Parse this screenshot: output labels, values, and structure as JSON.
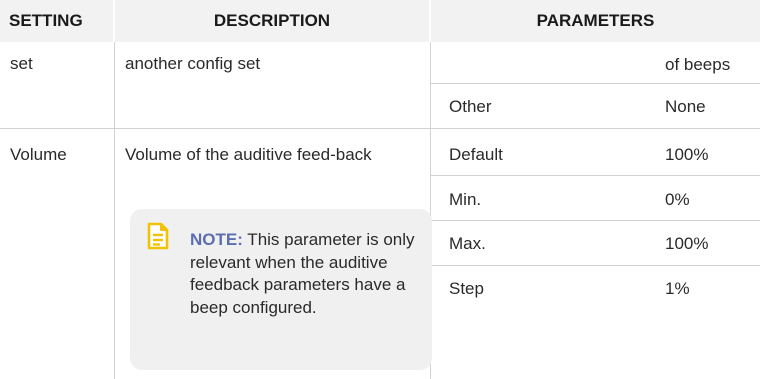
{
  "table": {
    "headers": {
      "setting": "SETTING",
      "description": "DESCRIPTION",
      "parameters": "PARAMETERS"
    },
    "row1": {
      "setting": "set",
      "description": "another config set",
      "params": [
        {
          "name": "",
          "value": "of beeps"
        },
        {
          "name": "Other",
          "value": "None"
        }
      ]
    },
    "row2": {
      "setting": "Volume",
      "description": "Volume of the auditive feed-back",
      "params": [
        {
          "name": "Default",
          "value": "100%"
        },
        {
          "name": "Min.",
          "value": "0%"
        },
        {
          "name": "Max.",
          "value": "100%"
        },
        {
          "name": "Step",
          "value": "1%"
        }
      ],
      "note": {
        "label": "NOTE:",
        "text": " This parameter is only relevant when the auditive feedback parameters have a beep configured.",
        "icon": "note-icon"
      }
    }
  },
  "colors": {
    "header_bg": "#f2f2f2",
    "note_bg": "#f0f0f0",
    "note_label": "#5b6fb0",
    "icon_yellow": "#f2c300"
  }
}
